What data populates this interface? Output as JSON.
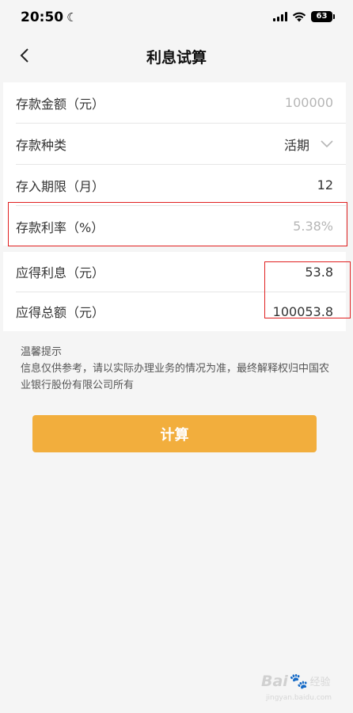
{
  "status_bar": {
    "time": "20:50",
    "battery": "63"
  },
  "nav": {
    "title": "利息试算"
  },
  "form": {
    "amount_label": "存款金额（元）",
    "amount_placeholder": "100000",
    "type_label": "存款种类",
    "type_value": "活期",
    "term_label": "存入期限（月）",
    "term_value": "12",
    "rate_label": "存款利率（%）",
    "rate_placeholder": "5.38%"
  },
  "results": {
    "interest_label": "应得利息（元）",
    "interest_value": "53.8",
    "total_label": "应得总额（元）",
    "total_value": "100053.8"
  },
  "tips": {
    "title": "温馨提示",
    "body": "信息仅供参考，请以实际办理业务的情况为准，最终解释权归中国农业银行股份有限公司所有"
  },
  "button": {
    "calculate_label": "计算"
  },
  "watermark": {
    "brand": "Bai",
    "suffix": "经验",
    "url": "jingyan.baidu.com"
  },
  "colors": {
    "accent": "#f2ae3d",
    "highlight": "#e02020",
    "background": "#f5f5f5"
  }
}
